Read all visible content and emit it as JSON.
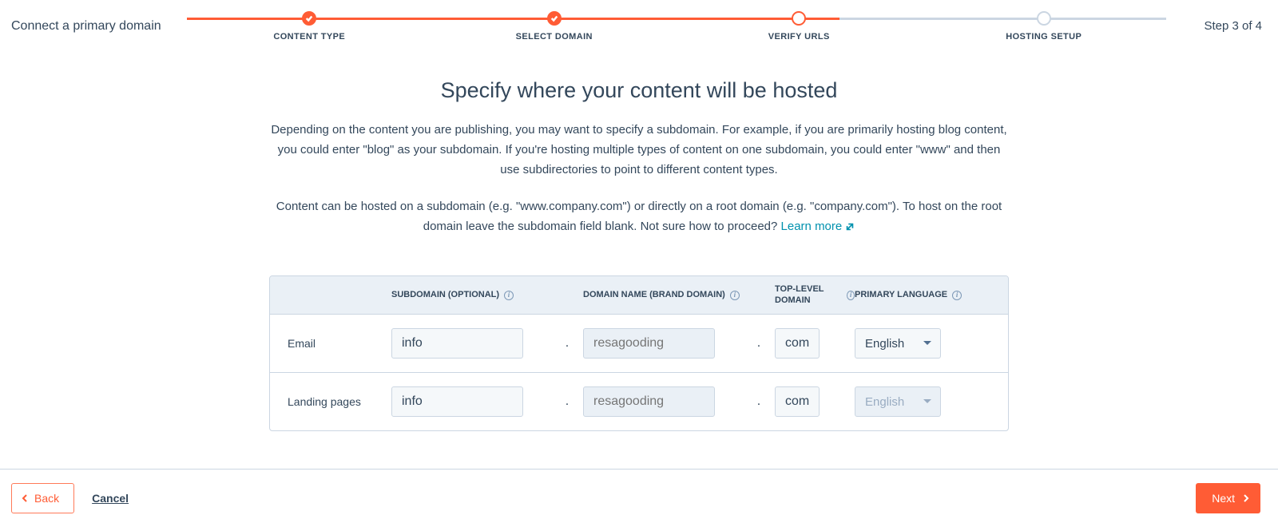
{
  "header": {
    "title": "Connect a primary domain",
    "step_indicator": "Step 3 of 4"
  },
  "stepper": {
    "steps": [
      {
        "label": "CONTENT TYPE"
      },
      {
        "label": "SELECT DOMAIN"
      },
      {
        "label": "VERIFY URLS"
      },
      {
        "label": "HOSTING SETUP"
      }
    ]
  },
  "main": {
    "headline": "Specify where your content will be hosted",
    "description1": "Depending on the content you are publishing, you may want to specify a subdomain. For example, if you are primarily hosting blog content, you could enter \"blog\" as your subdomain. If you're hosting multiple types of content on one subdomain, you could enter \"www\" and then use subdirectories to point to different content types.",
    "description2": "Content can be hosted on a subdomain (e.g. \"www.company.com\") or directly on a root domain (e.g. \"company.com\"). To host on the root domain leave the subdomain field blank. Not sure how to proceed? ",
    "learn_more": "Learn more"
  },
  "table": {
    "headers": {
      "subdomain": "SUBDOMAIN (OPTIONAL)",
      "domain_name": "DOMAIN NAME (BRAND DOMAIN)",
      "tld": "TOP-LEVEL DOMAIN",
      "language": "PRIMARY LANGUAGE"
    },
    "rows": [
      {
        "label": "Email",
        "subdomain_value": "info",
        "domain_name_placeholder": "resagooding",
        "tld_value": "com",
        "language_value": "English",
        "language_disabled": false
      },
      {
        "label": "Landing pages",
        "subdomain_value": "info",
        "domain_name_placeholder": "resagooding",
        "tld_value": "com",
        "language_value": "English",
        "language_disabled": true
      }
    ]
  },
  "footer": {
    "back_label": "Back",
    "cancel_label": "Cancel",
    "next_label": "Next"
  }
}
